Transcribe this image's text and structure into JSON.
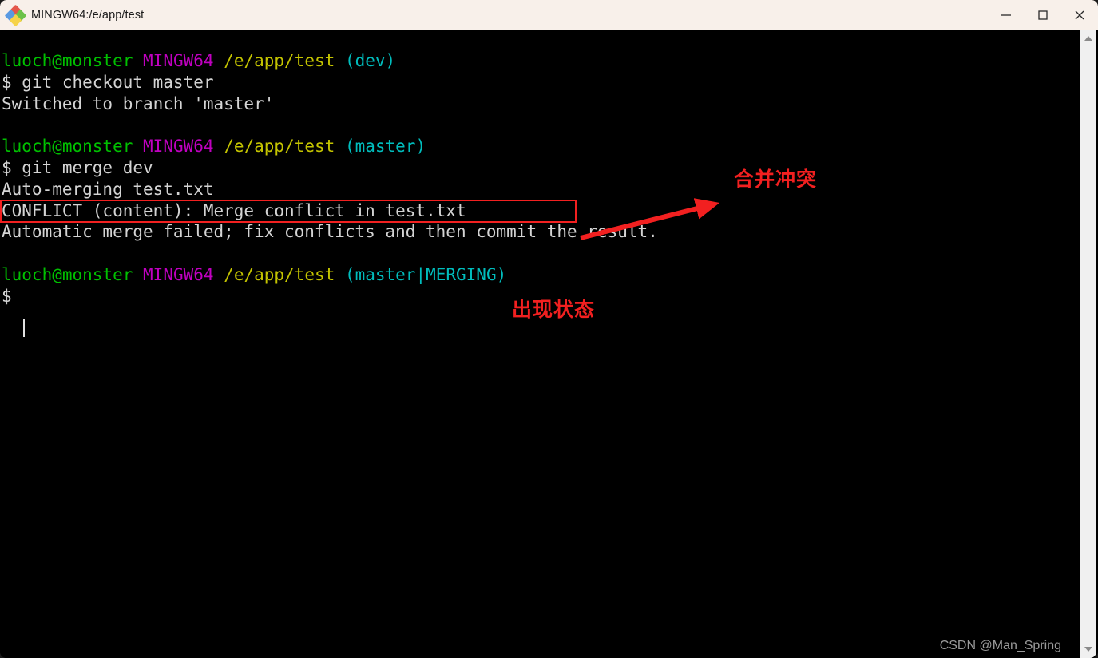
{
  "window": {
    "title": "MINGW64:/e/app/test",
    "icon": "git-bash-icon",
    "controls": {
      "minimize": "minimize-icon",
      "maximize": "maximize-icon",
      "close": "close-icon"
    }
  },
  "terminal": {
    "lines": [
      {
        "id": "prompt-1",
        "segments": [
          {
            "text": "luoch@monster",
            "color": "green"
          },
          {
            "text": " ",
            "color": "white"
          },
          {
            "text": "MINGW64",
            "color": "magenta"
          },
          {
            "text": " ",
            "color": "white"
          },
          {
            "text": "/e/app/test",
            "color": "yellow"
          },
          {
            "text": " ",
            "color": "white"
          },
          {
            "text": "(dev)",
            "color": "cyan"
          }
        ]
      },
      {
        "id": "command-1",
        "segments": [
          {
            "text": "$ git checkout master",
            "color": "white"
          }
        ]
      },
      {
        "id": "output-1",
        "segments": [
          {
            "text": "Switched to branch 'master'",
            "color": "white"
          }
        ]
      },
      {
        "id": "blank-1",
        "segments": [
          {
            "text": " ",
            "color": "white"
          }
        ]
      },
      {
        "id": "prompt-2",
        "segments": [
          {
            "text": "luoch@monster",
            "color": "green"
          },
          {
            "text": " ",
            "color": "white"
          },
          {
            "text": "MINGW64",
            "color": "magenta"
          },
          {
            "text": " ",
            "color": "white"
          },
          {
            "text": "/e/app/test",
            "color": "yellow"
          },
          {
            "text": " ",
            "color": "white"
          },
          {
            "text": "(master)",
            "color": "cyan"
          }
        ]
      },
      {
        "id": "command-2",
        "segments": [
          {
            "text": "$ git merge dev",
            "color": "white"
          }
        ]
      },
      {
        "id": "output-2",
        "segments": [
          {
            "text": "Auto-merging test.txt",
            "color": "white"
          }
        ]
      },
      {
        "id": "output-conflict",
        "segments": [
          {
            "text": "CONFLICT (content): Merge conflict in test.txt",
            "color": "white"
          }
        ]
      },
      {
        "id": "output-3",
        "segments": [
          {
            "text": "Automatic merge failed; fix conflicts and then commit the result.",
            "color": "white"
          }
        ]
      },
      {
        "id": "blank-2",
        "segments": [
          {
            "text": " ",
            "color": "white"
          }
        ]
      },
      {
        "id": "prompt-3",
        "segments": [
          {
            "text": "luoch@monster",
            "color": "green"
          },
          {
            "text": " ",
            "color": "white"
          },
          {
            "text": "MINGW64",
            "color": "magenta"
          },
          {
            "text": " ",
            "color": "white"
          },
          {
            "text": "/e/app/test",
            "color": "yellow"
          },
          {
            "text": " ",
            "color": "white"
          },
          {
            "text": "(master|MERGING)",
            "color": "cyan"
          }
        ]
      },
      {
        "id": "prompt-4",
        "segments": [
          {
            "text": "$ ",
            "color": "white"
          }
        ]
      }
    ],
    "colors": {
      "background": "#000000",
      "green": "#00c000",
      "magenta": "#c000c0",
      "yellow": "#c4c400",
      "cyan": "#00bdbd",
      "white": "#d4d4d4"
    }
  },
  "annotations": {
    "color": "#f22020",
    "merge_conflict_label": "合并冲突",
    "status_label": "出现状态",
    "highlight_target": "CONFLICT (content): Merge conflict in test.txt"
  },
  "watermark": {
    "text": "CSDN @Man_Spring"
  },
  "scrollbar": {
    "up_arrow": "scroll-up-icon",
    "down_arrow": "scroll-down-icon"
  }
}
